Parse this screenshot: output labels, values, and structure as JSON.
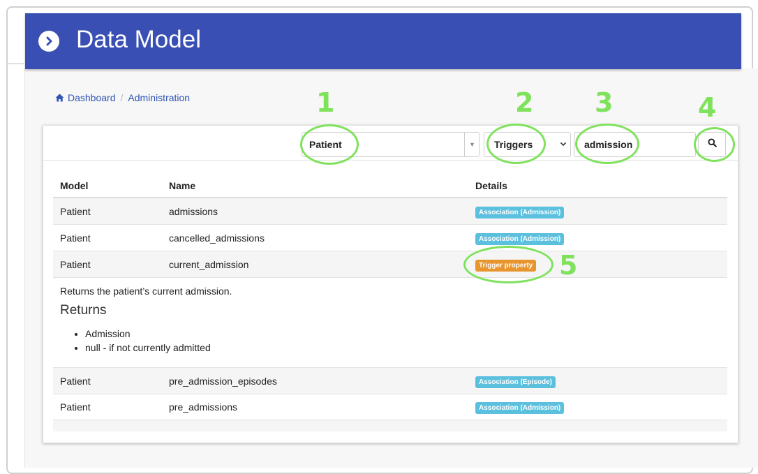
{
  "header": {
    "title": "Data Model"
  },
  "breadcrumb": {
    "home": "Dashboard",
    "current": "Administration"
  },
  "filters": {
    "model": "Patient",
    "type": "Triggers",
    "search": "admission"
  },
  "table": {
    "headers": {
      "model": "Model",
      "name": "Name",
      "details": "Details"
    },
    "rows": [
      {
        "model": "Patient",
        "name": "admissions",
        "badge": "Association (Admission)"
      },
      {
        "model": "Patient",
        "name": "cancelled_admissions",
        "badge": "Association (Admission)"
      },
      {
        "model": "Patient",
        "name": "current_admission",
        "badge": "Trigger property"
      },
      {
        "model": "Patient",
        "name": "pre_admission_episodes",
        "badge": "Association (Episode)"
      },
      {
        "model": "Patient",
        "name": "pre_admissions",
        "badge": "Association (Admission)"
      }
    ],
    "detail": {
      "description": "Returns the patient’s current admission.",
      "returns_heading": "Returns",
      "returns": [
        "Admission",
        "null - if not currently admitted"
      ]
    }
  },
  "colors": {
    "header": "#3a4fb3",
    "link": "#2f55b5",
    "association_badge": "#5bc0de",
    "trigger_badge": "#e8952e",
    "annotation": "#7fe25d"
  },
  "icons": {
    "header": "chevron-circle-right-icon",
    "breadcrumb": "home-icon",
    "search": "search-icon"
  },
  "annotations": [
    "1",
    "2",
    "3",
    "4",
    "5"
  ]
}
